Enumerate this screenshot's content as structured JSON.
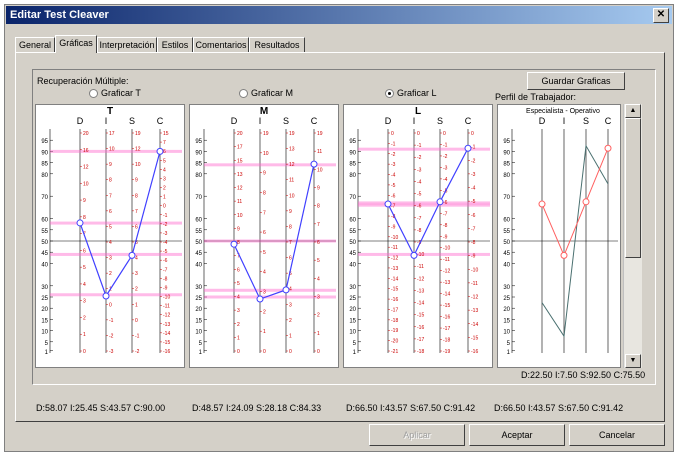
{
  "window": {
    "title": "Editar Test Cleaver",
    "close_glyph": "✕"
  },
  "tabs": [
    {
      "label": "General"
    },
    {
      "label": "Gráficas"
    },
    {
      "label": "Interpretación"
    },
    {
      "label": "Estilos"
    },
    {
      "label": "Comentarios"
    },
    {
      "label": "Resultados"
    }
  ],
  "recuperacion_label": "Recuperación Múltiple:",
  "radios": [
    {
      "label": "Graficar T",
      "checked": false
    },
    {
      "label": "Graficar M",
      "checked": false
    },
    {
      "label": "Graficar L",
      "checked": true
    }
  ],
  "guardar_button": "Guardar Graficas",
  "perfil_label": "Perfil de Trabajador:",
  "perfil_subtitle": "Especialista - Operativo",
  "chart_data": [
    {
      "type": "line",
      "title": "T",
      "columns": [
        "D",
        "I",
        "S",
        "C"
      ],
      "y_ticks": [
        95,
        90,
        85,
        80,
        70,
        60,
        55,
        50,
        45,
        40,
        30,
        25,
        20,
        15,
        10,
        5,
        1
      ],
      "values": [
        58.07,
        25.45,
        43.57,
        90.0
      ],
      "highlight_lines": [
        58,
        26,
        44,
        90
      ],
      "column_scales": {
        "D": [
          20,
          16,
          12,
          10,
          9,
          8,
          7,
          6,
          5,
          4,
          3,
          2,
          1,
          0
        ],
        "I": [
          17,
          10,
          9,
          8,
          7,
          6,
          5,
          4,
          3,
          2,
          1,
          0,
          -1,
          -2,
          -3
        ],
        "S": [
          19,
          12,
          10,
          9,
          8,
          7,
          6,
          5,
          4,
          3,
          2,
          1,
          0,
          -1,
          -2
        ],
        "C": [
          15,
          7,
          6,
          5,
          4,
          3,
          2,
          1,
          0,
          -1,
          -2,
          -3,
          -4,
          -5,
          -6,
          -7,
          -8,
          -9,
          -10,
          -11,
          -12,
          -13,
          -14,
          -15,
          -16
        ]
      },
      "footer": "D:58.07  I:25.45  S:43.57  C:90.00"
    },
    {
      "type": "line",
      "title": "M",
      "columns": [
        "D",
        "I",
        "S",
        "C"
      ],
      "y_ticks": [
        95,
        90,
        85,
        80,
        70,
        60,
        55,
        50,
        45,
        40,
        30,
        25,
        20,
        15,
        10,
        5,
        1
      ],
      "values": [
        48.57,
        24.09,
        28.18,
        84.33
      ],
      "highlight_lines": [
        84,
        50,
        28,
        25
      ],
      "column_scales": {
        "D": [
          20,
          17,
          15,
          13,
          12,
          11,
          10,
          9,
          8,
          7,
          6,
          5,
          4,
          3,
          2,
          1,
          0
        ],
        "I": [
          19,
          10,
          9,
          8,
          7,
          6,
          5,
          4,
          3,
          2,
          1,
          0
        ],
        "S": [
          19,
          13,
          12,
          11,
          10,
          9,
          8,
          7,
          6,
          5,
          4,
          3,
          2,
          1,
          0
        ],
        "C": [
          19,
          11,
          10,
          9,
          8,
          7,
          6,
          5,
          4,
          3,
          2,
          1,
          0
        ]
      },
      "footer": "D:48.57  I:24.09  S:28.18  C:84.33"
    },
    {
      "type": "line",
      "title": "L",
      "columns": [
        "D",
        "I",
        "S",
        "C"
      ],
      "y_ticks": [
        95,
        90,
        85,
        80,
        70,
        60,
        55,
        50,
        45,
        40,
        30,
        25,
        20,
        15,
        10,
        5,
        1
      ],
      "values": [
        66.5,
        43.57,
        67.5,
        91.42
      ],
      "highlight_lines": [
        91,
        67,
        66,
        44
      ],
      "column_scales": {
        "D": [
          0,
          -1,
          -2,
          -3,
          -4,
          -5,
          -6,
          -7,
          -8,
          -9,
          -10,
          -11,
          -12,
          -13,
          -14,
          -15,
          -16,
          -17,
          -18,
          -19,
          -20,
          -21
        ],
        "I": [
          0,
          -1,
          -2,
          -3,
          -4,
          -5,
          -6,
          -7,
          -8,
          -9,
          -10,
          -11,
          -12,
          -13,
          -14,
          -15,
          -16,
          -17,
          -18
        ],
        "S": [
          0,
          -1,
          -2,
          -3,
          -4,
          -5,
          -6,
          -7,
          -8,
          -9,
          -10,
          -11,
          -12,
          -13,
          -14,
          -15,
          -16,
          -17,
          -18,
          -19
        ],
        "C": [
          0,
          -1,
          -2,
          -3,
          -4,
          -5,
          -6,
          -7,
          -8,
          -9,
          -10,
          -11,
          -12,
          -13,
          -14,
          -15,
          -16
        ]
      },
      "footer": "D:66.50  I:43.57  S:67.50  C:91.42"
    },
    {
      "type": "line",
      "title": "Especialista - Operativo",
      "columns": [
        "D",
        "I",
        "S",
        "C"
      ],
      "y_ticks": [
        95,
        90,
        85,
        80,
        70,
        60,
        55,
        50,
        45,
        40,
        30,
        25,
        20,
        15,
        10,
        5,
        1
      ],
      "series": [
        {
          "values": [
            22.5,
            7.5,
            92.5,
            75.5
          ],
          "color": "#4a7070"
        },
        {
          "values": [
            66.5,
            43.57,
            67.5,
            91.42
          ],
          "color": "#ff6060"
        }
      ],
      "footer_top": "D:22.50  I:7.50  S:92.50  C:75.50",
      "footer": "D:66.50  I:43.57  S:67.50  C:91.42"
    }
  ],
  "footer_buttons": {
    "aplicar": "Aplicar",
    "aceptar": "Aceptar",
    "cancelar": "Cancelar"
  },
  "colors": {
    "title_bar": "#0a246a",
    "chart_line": "#4040ff",
    "highlight": "#ff66cc",
    "scale_red": "#cc0000",
    "perfil_series": "#ff6060"
  }
}
